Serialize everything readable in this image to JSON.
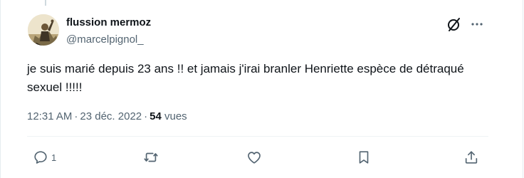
{
  "tweet": {
    "display_name": "flussion mermoz",
    "handle": "@marcelpignol_",
    "text": "je suis marié depuis 23 ans !! et jamais j'irai branler Henriette espèce de détraqué sexuel !!!!!",
    "time": "12:31 AM",
    "separator": "·",
    "date": "23 déc. 2022",
    "views_count": "54",
    "views_label": "vues"
  },
  "actions": {
    "reply_count": "1"
  },
  "icons": {
    "grok": "grok-icon",
    "more": "more-icon",
    "reply": "reply-icon",
    "retweet": "retweet-icon",
    "like": "heart-icon",
    "bookmark": "bookmark-icon",
    "share": "share-icon"
  },
  "colors": {
    "text_primary": "#0f1419",
    "text_secondary": "#536471",
    "divider": "#eff3f4"
  }
}
